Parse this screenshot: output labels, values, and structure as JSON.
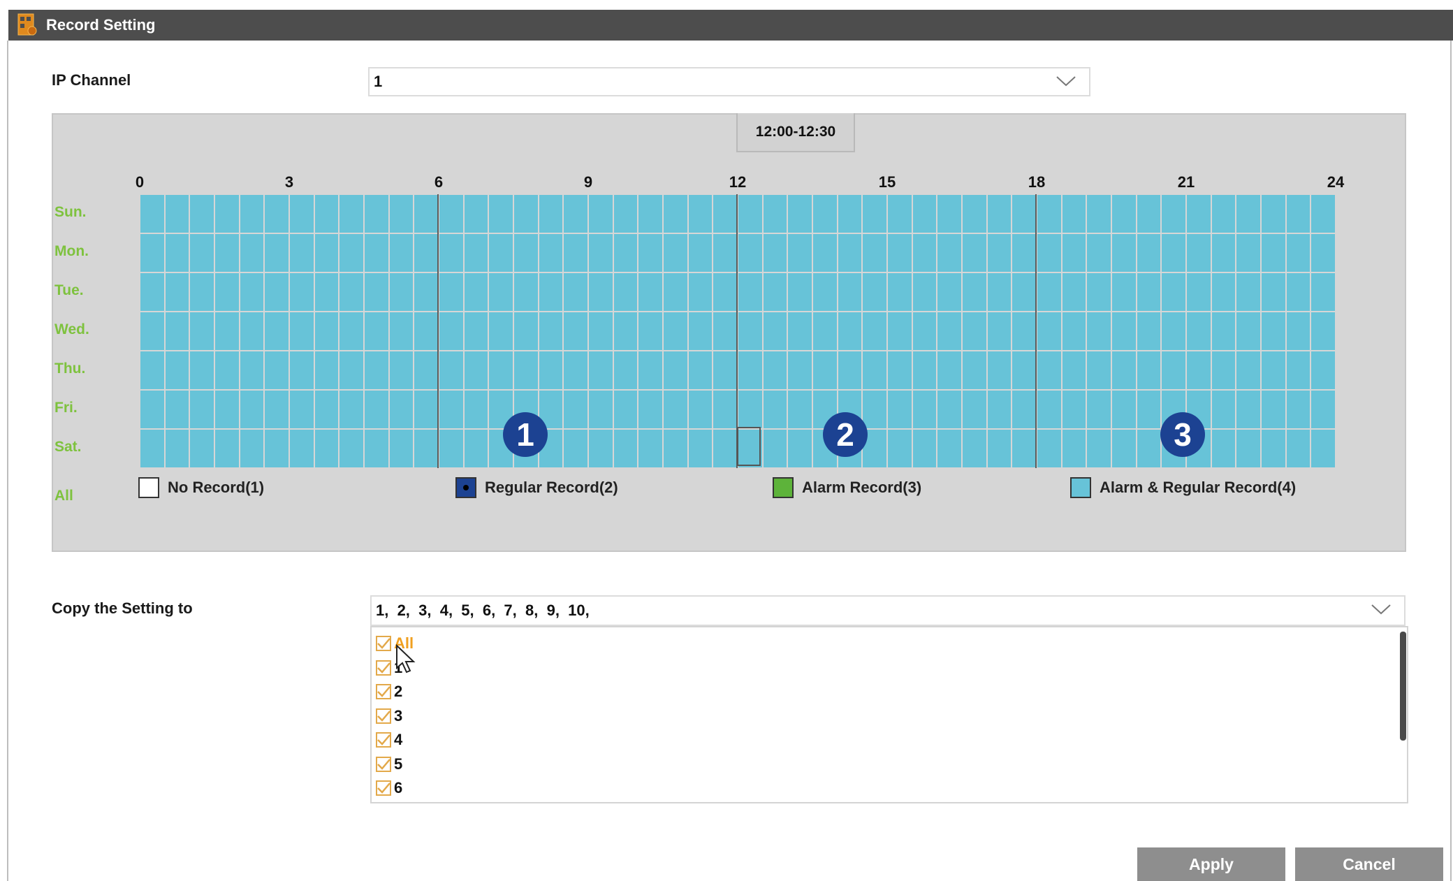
{
  "window": {
    "title": "Record Setting",
    "icon": "record-setting-icon"
  },
  "ip_channel": {
    "label": "IP Channel",
    "value": "1"
  },
  "schedule": {
    "selected_time": "12:00-12:30",
    "hour_labels": [
      "0",
      "3",
      "6",
      "9",
      "12",
      "15",
      "18",
      "21",
      "24"
    ],
    "days": [
      "Sun.",
      "Mon.",
      "Tue.",
      "Wed.",
      "Thu.",
      "Fri.",
      "Sat."
    ],
    "all_label": "All",
    "cell_color": "#67c3d8",
    "all_slots_mode": "Alarm & Regular Record(4)",
    "legend": [
      {
        "label": "No Record(1)",
        "color": "#ffffff"
      },
      {
        "label": "Regular Record(2)",
        "color": "#1c4292"
      },
      {
        "label": "Alarm Record(3)",
        "color": "#5db33a"
      },
      {
        "label": "Alarm & Regular Record(4)",
        "color": "#67c3d8"
      }
    ],
    "callouts": [
      "1",
      "2",
      "3"
    ]
  },
  "copy_setting": {
    "label": "Copy the Setting to",
    "value": "1,  2,  3,  4,  5,  6,  7,  8,  9,  10,",
    "options": [
      {
        "label": "All",
        "checked": true,
        "highlight": true
      },
      {
        "label": "1",
        "checked": true
      },
      {
        "label": "2",
        "checked": true
      },
      {
        "label": "3",
        "checked": true
      },
      {
        "label": "4",
        "checked": true
      },
      {
        "label": "5",
        "checked": true
      },
      {
        "label": "6",
        "checked": true
      }
    ]
  },
  "buttons": {
    "apply": "Apply",
    "cancel": "Cancel"
  },
  "colors": {
    "titlebar": "#4d4d4d",
    "day_label": "#7ec23e",
    "checkbox": "#e3a94a",
    "all_option": "#f0a020"
  }
}
